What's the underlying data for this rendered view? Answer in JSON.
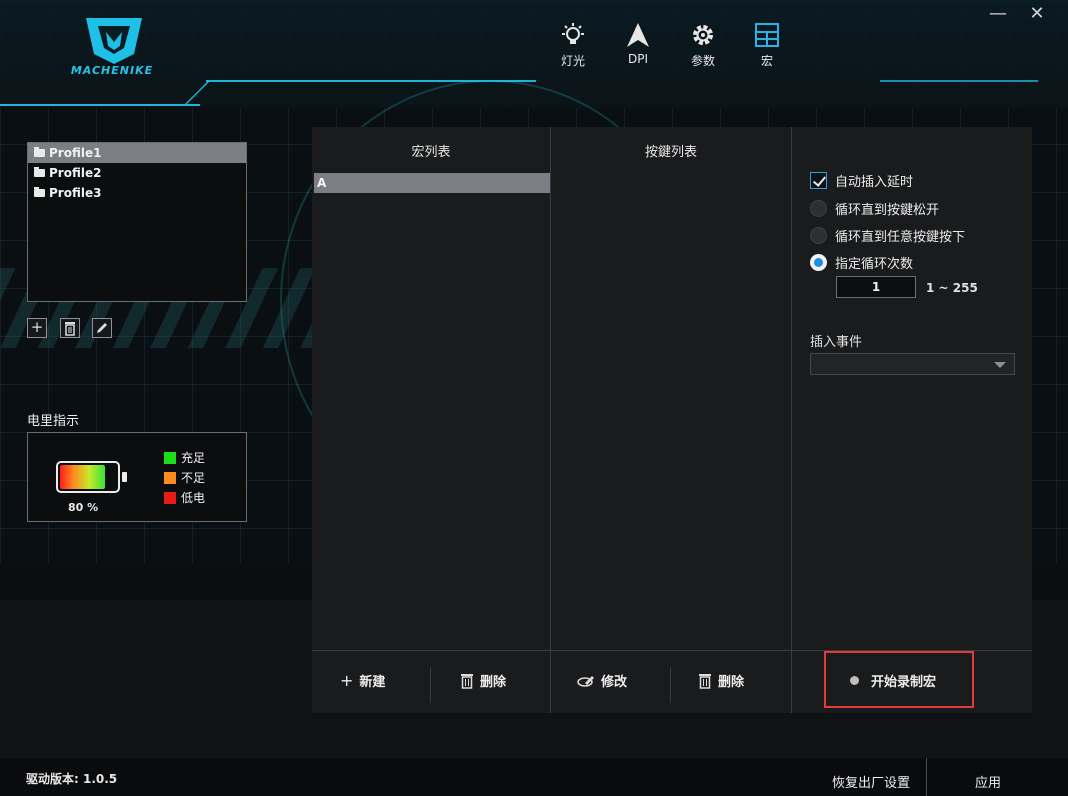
{
  "app": {
    "brand": "MACHENIKE"
  },
  "window": {
    "minimize_symbol": "—",
    "close_symbol": "✕"
  },
  "nav": [
    {
      "label": "灯光",
      "icon": "light-bulb-icon"
    },
    {
      "label": "DPI",
      "icon": "arrow-cursor-icon"
    },
    {
      "label": "参数",
      "icon": "gear-icon"
    },
    {
      "label": "宏",
      "icon": "grid-icon"
    }
  ],
  "profiles": {
    "items": [
      "Profile1",
      "Profile2",
      "Profile3"
    ],
    "selected": "Profile1",
    "add_symbol": "+",
    "delete_symbol": "🗑",
    "edit_symbol": "✎"
  },
  "battery": {
    "label": "电里指示",
    "percent_text": "80 %",
    "level": 0.8,
    "legend": [
      {
        "label": "充足",
        "color": "#19e019"
      },
      {
        "label": "不足",
        "color": "#ff8a1e"
      },
      {
        "label": "低电",
        "color": "#e81a1a"
      }
    ]
  },
  "macro": {
    "macro_list_header": "宏列表",
    "key_list_header": "按鍵列表",
    "macros": [
      "A"
    ],
    "options": {
      "auto_delay": "自动插入延时",
      "loop_until_release": "循环直到按鍵松开",
      "loop_until_any": "循环直到任意按鍵按下",
      "loop_count": "指定循环次数",
      "count_value": "1",
      "count_range": "1 ~ 255"
    },
    "insert_event_label": "插入事件",
    "insert_event_value": "",
    "footer": {
      "new": "新建",
      "delete_macro": "删除",
      "modify": "修改",
      "delete_key": "删除",
      "record": "开始录制宏"
    }
  },
  "status": {
    "version": "驱动版本: 1.0.5",
    "reset": "恢复出厂设置",
    "apply": "应用"
  },
  "colors": {
    "accent": "#1fb6d6",
    "highlight": "#e23b3b",
    "radio_on": "#1e8fe0"
  }
}
